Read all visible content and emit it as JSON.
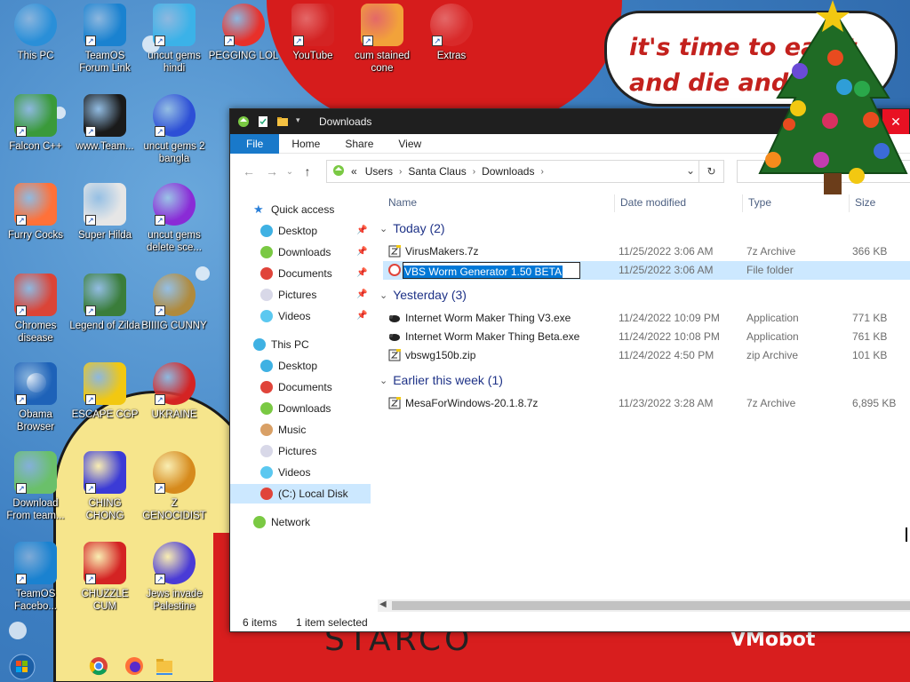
{
  "wallpaper": {
    "bubble_text": "it's time to eat it and die and",
    "bottom_text": "STARCO",
    "corner_text": "VMobot"
  },
  "desktop_icons": [
    {
      "label": "This PC",
      "icon": "computer-icon"
    },
    {
      "label": "TeamOS Forum Link",
      "icon": "gear-icon"
    },
    {
      "label": "uncut gems hindi",
      "icon": "diamond-icon"
    },
    {
      "label": "PEGGING LOL",
      "icon": "p-logo-icon"
    },
    {
      "label": "YouTube",
      "icon": "angry-bird-icon"
    },
    {
      "label": "cum stained cone",
      "icon": "cone-icon"
    },
    {
      "label": "Extras",
      "icon": "extras-icon"
    },
    {
      "label": "Falcon C++",
      "icon": "recycle-icon"
    },
    {
      "label": "www.Team...",
      "icon": "book-icon"
    },
    {
      "label": "uncut gems 2 bangla",
      "icon": "number-two-icon"
    },
    {
      "label": "Furry Cocks",
      "icon": "firefox-icon"
    },
    {
      "label": "Super Hilda",
      "icon": "pixel-cat-icon"
    },
    {
      "label": "uncut gems delete sce...",
      "icon": "gem-orb-icon"
    },
    {
      "label": "Chromes disease",
      "icon": "chrome-icon"
    },
    {
      "label": "Legend of Zilda",
      "icon": "pixel-hero-icon"
    },
    {
      "label": "BIIIIG CUNNY",
      "icon": "money-bag-icon"
    },
    {
      "label": "Obama Browser",
      "icon": "obama-logo-icon"
    },
    {
      "label": "ESCAPE CGP",
      "icon": "mahjong-icon"
    },
    {
      "label": "UKRAINE",
      "icon": "radiation-icon"
    },
    {
      "label": "Download From team...",
      "icon": "notepad-icon"
    },
    {
      "label": "CHING CHONG",
      "icon": "bomb-orb-icon"
    },
    {
      "label": "Z GENOCIDIST",
      "icon": "tiles-icon"
    },
    {
      "label": "TeamOS Facebo...",
      "icon": "gear-icon"
    },
    {
      "label": "CHUZZLE CUM",
      "icon": "chuzzle-icon"
    },
    {
      "label": "Jews invade Palestine",
      "icon": "orb-icon"
    }
  ],
  "explorer": {
    "title": "Downloads",
    "close_glyph": "✕",
    "ribbon_tabs": [
      "File",
      "Home",
      "Share",
      "View"
    ],
    "nav_back": "←",
    "nav_forward": "→",
    "nav_recent": "⌄",
    "nav_up": "↑",
    "address": {
      "prefix": "«",
      "crumbs": [
        "Users",
        "Santa Claus",
        "Downloads"
      ],
      "separator": "›",
      "dropdown": "⌄",
      "refresh": "↻"
    },
    "nav_pane": {
      "quick_access": "Quick access",
      "quick_items": [
        "Desktop",
        "Downloads",
        "Documents",
        "Pictures",
        "Videos"
      ],
      "this_pc": "This PC",
      "pc_items": [
        "Desktop",
        "Documents",
        "Downloads",
        "Music",
        "Pictures",
        "Videos",
        "(C:) Local Disk"
      ],
      "network": "Network"
    },
    "columns": [
      "Name",
      "Date modified",
      "Type",
      "Size"
    ],
    "groups": [
      {
        "label": "Today (2)",
        "files": [
          {
            "name": "VirusMakers.7z",
            "date": "11/25/2022 3:06 AM",
            "type": "7z Archive",
            "size": "366 KB"
          },
          {
            "name": "VBS Worm Generator 1.50 BETA",
            "date": "11/25/2022 3:06 AM",
            "type": "File folder",
            "size": ""
          }
        ]
      },
      {
        "label": "Yesterday (3)",
        "files": [
          {
            "name": "Internet Worm Maker Thing V3.exe",
            "date": "11/24/2022 10:09 PM",
            "type": "Application",
            "size": "771 KB"
          },
          {
            "name": "Internet Worm Maker Thing Beta.exe",
            "date": "11/24/2022 10:08 PM",
            "type": "Application",
            "size": "761 KB"
          },
          {
            "name": "vbswg150b.zip",
            "date": "11/24/2022 4:50 PM",
            "type": "zip Archive",
            "size": "101 KB"
          }
        ]
      },
      {
        "label": "Earlier this week (1)",
        "files": [
          {
            "name": "MesaForWindows-20.1.8.7z",
            "date": "11/23/2022 3:28 AM",
            "type": "7z Archive",
            "size": "6,895 KB"
          }
        ]
      }
    ],
    "status": {
      "items": "6 items",
      "selected": "1 item selected"
    }
  },
  "colors": {
    "accent": "#1979ca",
    "selection": "#cce8ff",
    "group_text": "#1e3287",
    "close_red": "#e81123"
  }
}
